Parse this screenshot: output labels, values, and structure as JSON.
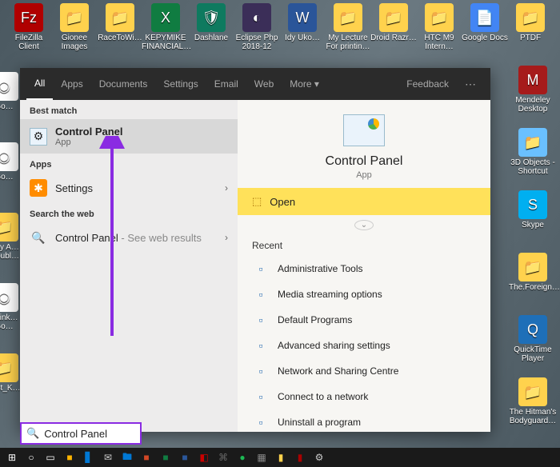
{
  "desktop_icons": {
    "row1": [
      {
        "name": "filezilla",
        "label": "FileZilla Client",
        "color": "#b00000",
        "glyph": "Fz"
      },
      {
        "name": "gionee",
        "label": "Gionee Images",
        "color": "#ffd24d",
        "glyph": "📁"
      },
      {
        "name": "racetowi",
        "label": "RaceToWi…",
        "color": "#ffd24d",
        "glyph": "📁"
      },
      {
        "name": "kepymike",
        "label": "KEPYMIKE FINANCIAL…",
        "color": "#107c41",
        "glyph": "X"
      },
      {
        "name": "dashlane",
        "label": "Dashlane",
        "color": "#0e7a5f",
        "glyph": "🛡"
      },
      {
        "name": "eclipse",
        "label": "Eclipse Php 2018-12",
        "color": "#3b2e58",
        "glyph": "◐"
      },
      {
        "name": "idyuko",
        "label": "Idy Uko…",
        "color": "#2a5599",
        "glyph": "W"
      },
      {
        "name": "mylecture",
        "label": "My Lecture For printin…",
        "color": "#ffd24d",
        "glyph": "📁"
      },
      {
        "name": "droidrazr",
        "label": "Droid Razr…",
        "color": "#ffd24d",
        "glyph": "📁"
      },
      {
        "name": "htcm9",
        "label": "HTC M9 Intern…",
        "color": "#ffd24d",
        "glyph": "📁"
      },
      {
        "name": "googledocs",
        "label": "Google Docs",
        "color": "#4285f4",
        "glyph": "📄"
      },
      {
        "name": "ptdf",
        "label": "PTDF",
        "color": "#ffd24d",
        "glyph": "📁"
      }
    ],
    "right_col": [
      {
        "name": "mendeley",
        "label": "Mendeley Desktop",
        "color": "#a61b1b",
        "glyph": "M"
      },
      {
        "name": "3dobjects",
        "label": "3D Objects - Shortcut",
        "color": "#6ac0ff",
        "glyph": "📁"
      },
      {
        "name": "skype",
        "label": "Skype",
        "color": "#00aff0",
        "glyph": "S"
      },
      {
        "name": "foreign",
        "label": "The.Foreign…",
        "color": "#ffd24d",
        "glyph": "📁"
      },
      {
        "name": "quicktime",
        "label": "QuickTime Player",
        "color": "#1e6fb8",
        "glyph": "Q"
      },
      {
        "name": "hitman",
        "label": "The Hitman's Bodyguard…",
        "color": "#ffd24d",
        "glyph": "📁"
      }
    ],
    "left_col": [
      {
        "name": "chrome1",
        "label": "Go…",
        "color": "#fff",
        "glyph": "◉"
      },
      {
        "name": "chrome2",
        "label": "Go…",
        "color": "#fff",
        "glyph": "◉"
      },
      {
        "name": "iggy",
        "label": "Iggy A… Troubl…",
        "color": "#ffd24d",
        "glyph": "📁"
      },
      {
        "name": "chrome3",
        "label": "Phink… Go…",
        "color": "#fff",
        "glyph": "◉"
      },
      {
        "name": "lastk",
        "label": "Last_K…",
        "color": "#ffd24d",
        "glyph": "📁"
      }
    ]
  },
  "tabs": [
    {
      "key": "all",
      "label": "All",
      "active": true
    },
    {
      "key": "apps",
      "label": "Apps"
    },
    {
      "key": "documents",
      "label": "Documents"
    },
    {
      "key": "settings",
      "label": "Settings"
    },
    {
      "key": "email",
      "label": "Email"
    },
    {
      "key": "web",
      "label": "Web"
    },
    {
      "key": "more",
      "label": "More ▾"
    }
  ],
  "feedback_label": "Feedback",
  "left": {
    "best_match": "Best match",
    "control_panel": {
      "title": "Control Panel",
      "sub": "App"
    },
    "apps_h": "Apps",
    "settings_label": "Settings",
    "search_web_h": "Search the web",
    "web_result": {
      "title": "Control Panel",
      "hint": " - See web results"
    }
  },
  "right": {
    "title": "Control Panel",
    "sub": "App",
    "open": "Open",
    "recent_h": "Recent",
    "recent": [
      "Administrative Tools",
      "Media streaming options",
      "Default Programs",
      "Advanced sharing settings",
      "Network and Sharing Centre",
      "Connect to a network",
      "Uninstall a program"
    ]
  },
  "search_value": "Control Panel"
}
